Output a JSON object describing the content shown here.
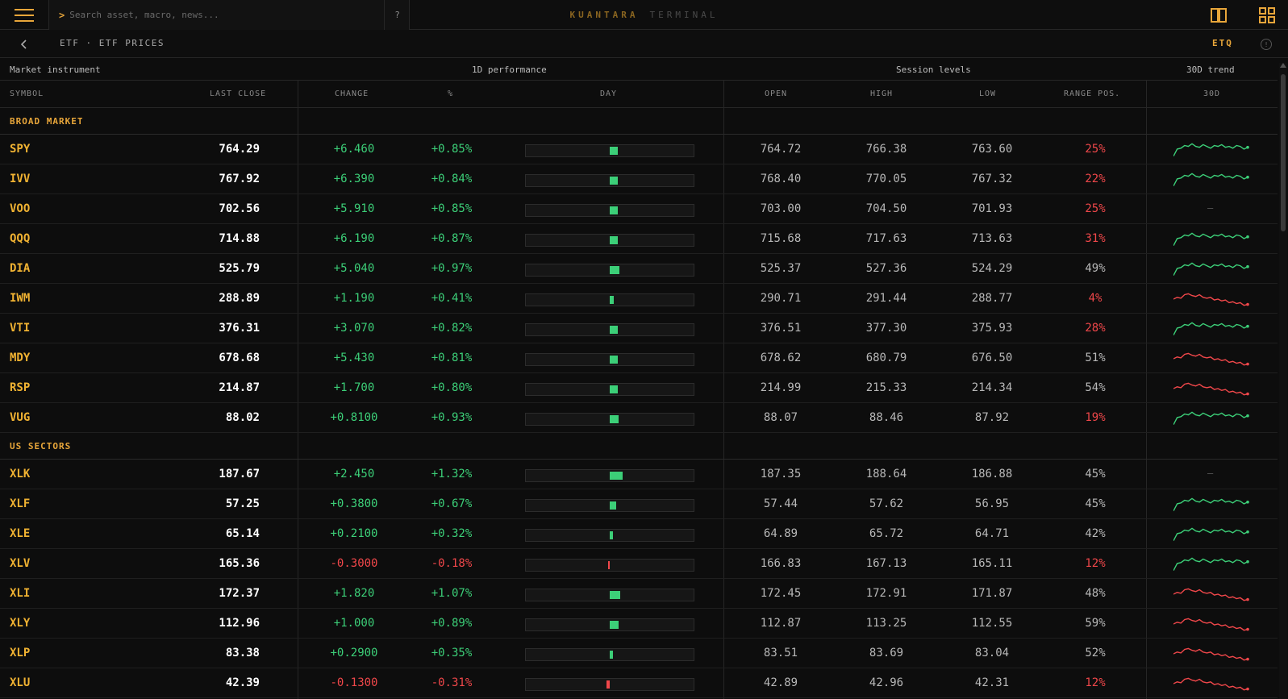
{
  "topbar": {
    "search_prompt": ">",
    "search_placeholder": "Search asset, macro, news...",
    "help_label": "?",
    "brand_primary": "KUANTARA",
    "brand_secondary": "TERMINAL",
    "menu_icon": "hamburger-menu-icon",
    "split_icon": "split-columns-icon",
    "grid_icon": "grid-layout-icon",
    "accent": "#e8a63a"
  },
  "breadcrumb": {
    "text": "ETF · ETF PRICES",
    "code": "ETQ",
    "info_icon": "info-icon",
    "info_label": "!"
  },
  "table": {
    "groups": {
      "instrument": "Market instrument",
      "performance": "1D performance",
      "session": "Session levels",
      "trend": "30D trend"
    },
    "columns": {
      "symbol": "SYMBOL",
      "last_close": "LAST CLOSE",
      "change": "CHANGE",
      "pct": "%",
      "day": "DAY",
      "open": "OPEN",
      "high": "HIGH",
      "low": "LOW",
      "range_pos": "RANGE POS.",
      "trend": "30D"
    },
    "sections": [
      {
        "title": "BROAD MARKET",
        "rows": [
          {
            "symbol": "SPY",
            "last": "764.29",
            "change": "+6.460",
            "pct": "+0.85%",
            "day": 0.85,
            "open": "764.72",
            "high": "766.38",
            "low": "763.60",
            "range": "25%",
            "spark": "up"
          },
          {
            "symbol": "IVV",
            "last": "767.92",
            "change": "+6.390",
            "pct": "+0.84%",
            "day": 0.84,
            "open": "768.40",
            "high": "770.05",
            "low": "767.32",
            "range": "22%",
            "spark": "up"
          },
          {
            "symbol": "VOO",
            "last": "702.56",
            "change": "+5.910",
            "pct": "+0.85%",
            "day": 0.85,
            "open": "703.00",
            "high": "704.50",
            "low": "701.93",
            "range": "25%",
            "spark": "none"
          },
          {
            "symbol": "QQQ",
            "last": "714.88",
            "change": "+6.190",
            "pct": "+0.87%",
            "day": 0.87,
            "open": "715.68",
            "high": "717.63",
            "low": "713.63",
            "range": "31%",
            "spark": "up"
          },
          {
            "symbol": "DIA",
            "last": "525.79",
            "change": "+5.040",
            "pct": "+0.97%",
            "day": 0.97,
            "open": "525.37",
            "high": "527.36",
            "low": "524.29",
            "range": "49%",
            "spark": "up"
          },
          {
            "symbol": "IWM",
            "last": "288.89",
            "change": "+1.190",
            "pct": "+0.41%",
            "day": 0.41,
            "open": "290.71",
            "high": "291.44",
            "low": "288.77",
            "range": "4%",
            "spark": "down"
          },
          {
            "symbol": "VTI",
            "last": "376.31",
            "change": "+3.070",
            "pct": "+0.82%",
            "day": 0.82,
            "open": "376.51",
            "high": "377.30",
            "low": "375.93",
            "range": "28%",
            "spark": "up"
          },
          {
            "symbol": "MDY",
            "last": "678.68",
            "change": "+5.430",
            "pct": "+0.81%",
            "day": 0.81,
            "open": "678.62",
            "high": "680.79",
            "low": "676.50",
            "range": "51%",
            "spark": "down"
          },
          {
            "symbol": "RSP",
            "last": "214.87",
            "change": "+1.700",
            "pct": "+0.80%",
            "day": 0.8,
            "open": "214.99",
            "high": "215.33",
            "low": "214.34",
            "range": "54%",
            "spark": "down"
          },
          {
            "symbol": "VUG",
            "last": "88.02",
            "change": "+0.8100",
            "pct": "+0.93%",
            "day": 0.93,
            "open": "88.07",
            "high": "88.46",
            "low": "87.92",
            "range": "19%",
            "spark": "up"
          }
        ]
      },
      {
        "title": "US SECTORS",
        "rows": [
          {
            "symbol": "XLK",
            "last": "187.67",
            "change": "+2.450",
            "pct": "+1.32%",
            "day": 1.32,
            "open": "187.35",
            "high": "188.64",
            "low": "186.88",
            "range": "45%",
            "spark": "none"
          },
          {
            "symbol": "XLF",
            "last": "57.25",
            "change": "+0.3800",
            "pct": "+0.67%",
            "day": 0.67,
            "open": "57.44",
            "high": "57.62",
            "low": "56.95",
            "range": "45%",
            "spark": "up"
          },
          {
            "symbol": "XLE",
            "last": "65.14",
            "change": "+0.2100",
            "pct": "+0.32%",
            "day": 0.32,
            "open": "64.89",
            "high": "65.72",
            "low": "64.71",
            "range": "42%",
            "spark": "up"
          },
          {
            "symbol": "XLV",
            "last": "165.36",
            "change": "-0.3000",
            "pct": "-0.18%",
            "day": -0.18,
            "open": "166.83",
            "high": "167.13",
            "low": "165.11",
            "range": "12%",
            "spark": "up"
          },
          {
            "symbol": "XLI",
            "last": "172.37",
            "change": "+1.820",
            "pct": "+1.07%",
            "day": 1.07,
            "open": "172.45",
            "high": "172.91",
            "low": "171.87",
            "range": "48%",
            "spark": "down"
          },
          {
            "symbol": "XLY",
            "last": "112.96",
            "change": "+1.000",
            "pct": "+0.89%",
            "day": 0.89,
            "open": "112.87",
            "high": "113.25",
            "low": "112.55",
            "range": "59%",
            "spark": "down"
          },
          {
            "symbol": "XLP",
            "last": "83.38",
            "change": "+0.2900",
            "pct": "+0.35%",
            "day": 0.35,
            "open": "83.51",
            "high": "83.69",
            "low": "83.04",
            "range": "52%",
            "spark": "down"
          },
          {
            "symbol": "XLU",
            "last": "42.39",
            "change": "-0.1300",
            "pct": "-0.31%",
            "day": -0.31,
            "open": "42.89",
            "high": "42.96",
            "low": "42.31",
            "range": "12%",
            "spark": "down"
          }
        ]
      }
    ],
    "empty_trend": "–"
  },
  "colors": {
    "positive": "#3ccf78",
    "negative": "#f0474a",
    "accent": "#e8a63a"
  }
}
